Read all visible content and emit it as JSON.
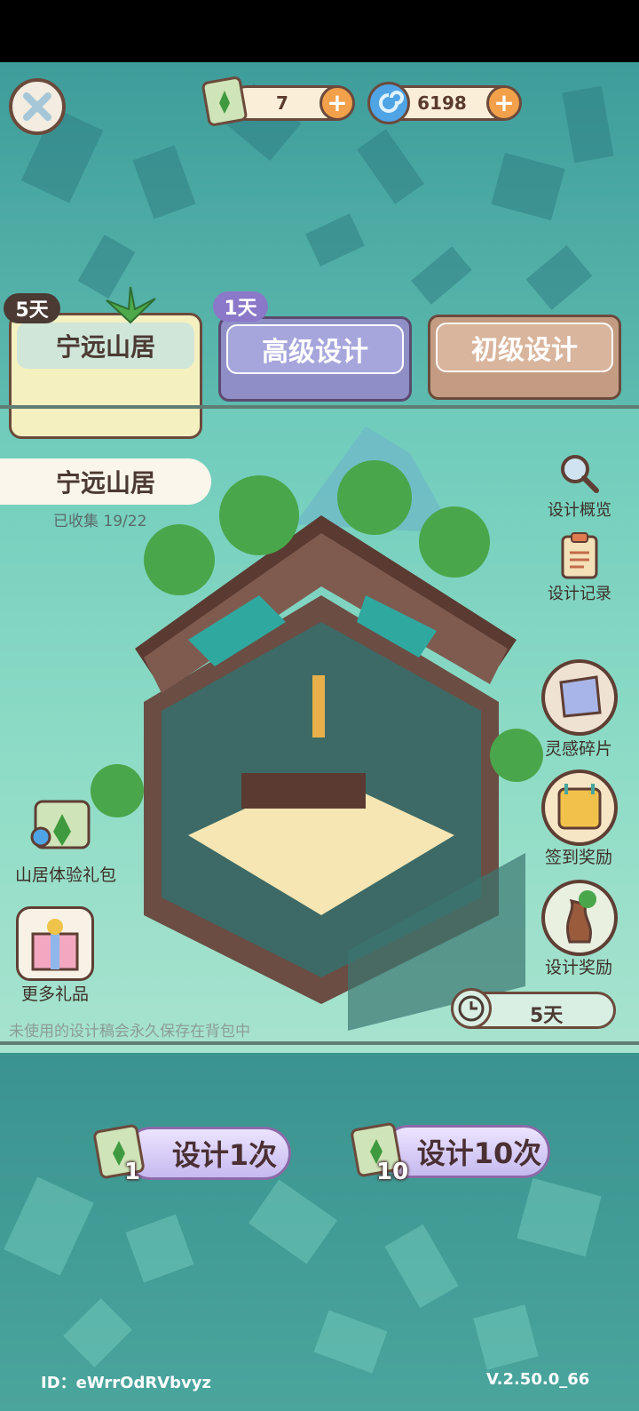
{
  "header": {
    "close_icon": "close-icon",
    "scroll_count": "7",
    "spiral_count": "6198"
  },
  "tabs": [
    {
      "label": "宁远山居",
      "days": "5天"
    },
    {
      "label": "高级设计",
      "days": "1天"
    },
    {
      "label": "初级设计"
    }
  ],
  "set": {
    "name": "宁远山居",
    "collected": "已收集 19/22"
  },
  "side_right": [
    {
      "label": "设计概览",
      "icon": "magnifier-icon"
    },
    {
      "label": "设计记录",
      "icon": "clipboard-icon"
    },
    {
      "label": "灵感碎片",
      "icon": "map-fragment-icon"
    },
    {
      "label": "签到奖励",
      "icon": "calendar-icon"
    },
    {
      "label": "设计奖励",
      "icon": "bonsai-icon"
    }
  ],
  "side_left": [
    {
      "label": "山居体验礼包",
      "icon": "scroll-bundle-icon"
    },
    {
      "label": "更多礼品",
      "icon": "gift-icon"
    }
  ],
  "hint": "未使用的设计稿会永久保存在背包中",
  "timer": "5天",
  "buttons": {
    "once_label": "设计1次",
    "once_cost": "1",
    "ten_label": "设计10次",
    "ten_cost": "10"
  },
  "footer": {
    "id": "ID：eWrrOdRVbvyz",
    "version": "V.2.50.0_66"
  },
  "colors": {
    "accent_purple": "#8f8ec7",
    "accent_tan": "#c49c83",
    "teal": "#4aa59d"
  }
}
